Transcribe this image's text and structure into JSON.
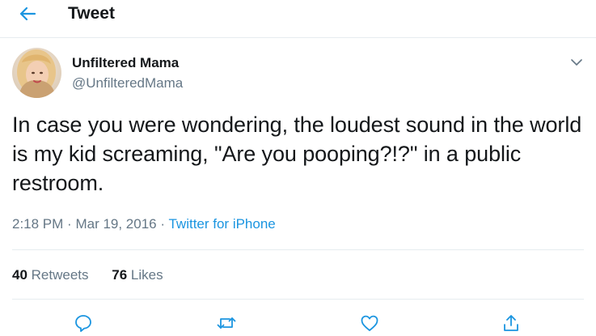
{
  "header": {
    "title": "Tweet",
    "back_icon": "arrow-left-icon"
  },
  "author": {
    "name": "Unfiltered Mama",
    "handle": "@UnfilteredMama",
    "avatar": "profile-photo"
  },
  "tweet": {
    "text": "In case you were wondering, the loudest sound in the world is my kid screaming, \"Are you pooping?!?\" in a public restroom.",
    "time": "2:18 PM",
    "date": "Mar 19, 2016",
    "source": "Twitter for iPhone",
    "separator": "·"
  },
  "stats": {
    "retweets": "40",
    "retweets_label": "Retweets",
    "likes": "76",
    "likes_label": "Likes"
  },
  "actions": [
    "reply-icon",
    "retweet-icon",
    "like-icon",
    "share-icon"
  ],
  "colors": {
    "accent": "#1b95e0",
    "muted": "#657786",
    "text": "#14171a",
    "divider": "#e6ecf0"
  }
}
